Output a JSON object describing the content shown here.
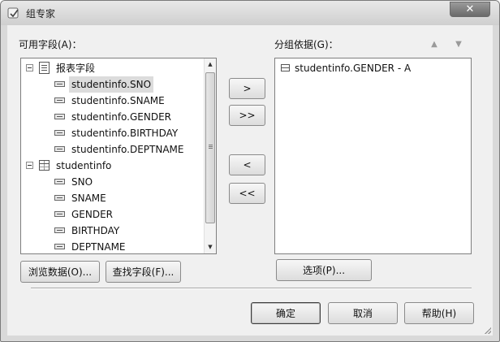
{
  "window": {
    "title": "组专家",
    "close_label": "✕"
  },
  "available_fields": {
    "label": "可用字段(A)：",
    "tree": [
      {
        "label": "报表字段",
        "kind": "report-group",
        "depth": 0
      },
      {
        "label": "studentinfo.SNO",
        "kind": "field",
        "depth": 1,
        "selected": true
      },
      {
        "label": "studentinfo.SNAME",
        "kind": "field",
        "depth": 1
      },
      {
        "label": "studentinfo.GENDER",
        "kind": "field",
        "depth": 1
      },
      {
        "label": "studentinfo.BIRTHDAY",
        "kind": "field",
        "depth": 1
      },
      {
        "label": "studentinfo.DEPTNAME",
        "kind": "field",
        "depth": 1
      },
      {
        "label": "studentinfo",
        "kind": "table",
        "depth": 0
      },
      {
        "label": "SNO",
        "kind": "field",
        "depth": 1
      },
      {
        "label": "SNAME",
        "kind": "field",
        "depth": 1
      },
      {
        "label": "GENDER",
        "kind": "field",
        "depth": 1
      },
      {
        "label": "BIRTHDAY",
        "kind": "field",
        "depth": 1
      },
      {
        "label": "DEPTNAME",
        "kind": "field",
        "depth": 1
      }
    ]
  },
  "group_by": {
    "label": "分组依据(G)：",
    "items": [
      {
        "label": "studentinfo.GENDER - A"
      }
    ],
    "move_up_icon": "arrow-up",
    "move_down_icon": "arrow-down"
  },
  "transfer_buttons": {
    "add": ">",
    "add_all": ">>",
    "remove": "<",
    "remove_all": "<<"
  },
  "buttons": {
    "browse_data": "浏览数据(O)...",
    "find_field": "查找字段(F)...",
    "options": "选项(P)...",
    "ok": "确定",
    "cancel": "取消",
    "help": "帮助(H)"
  }
}
